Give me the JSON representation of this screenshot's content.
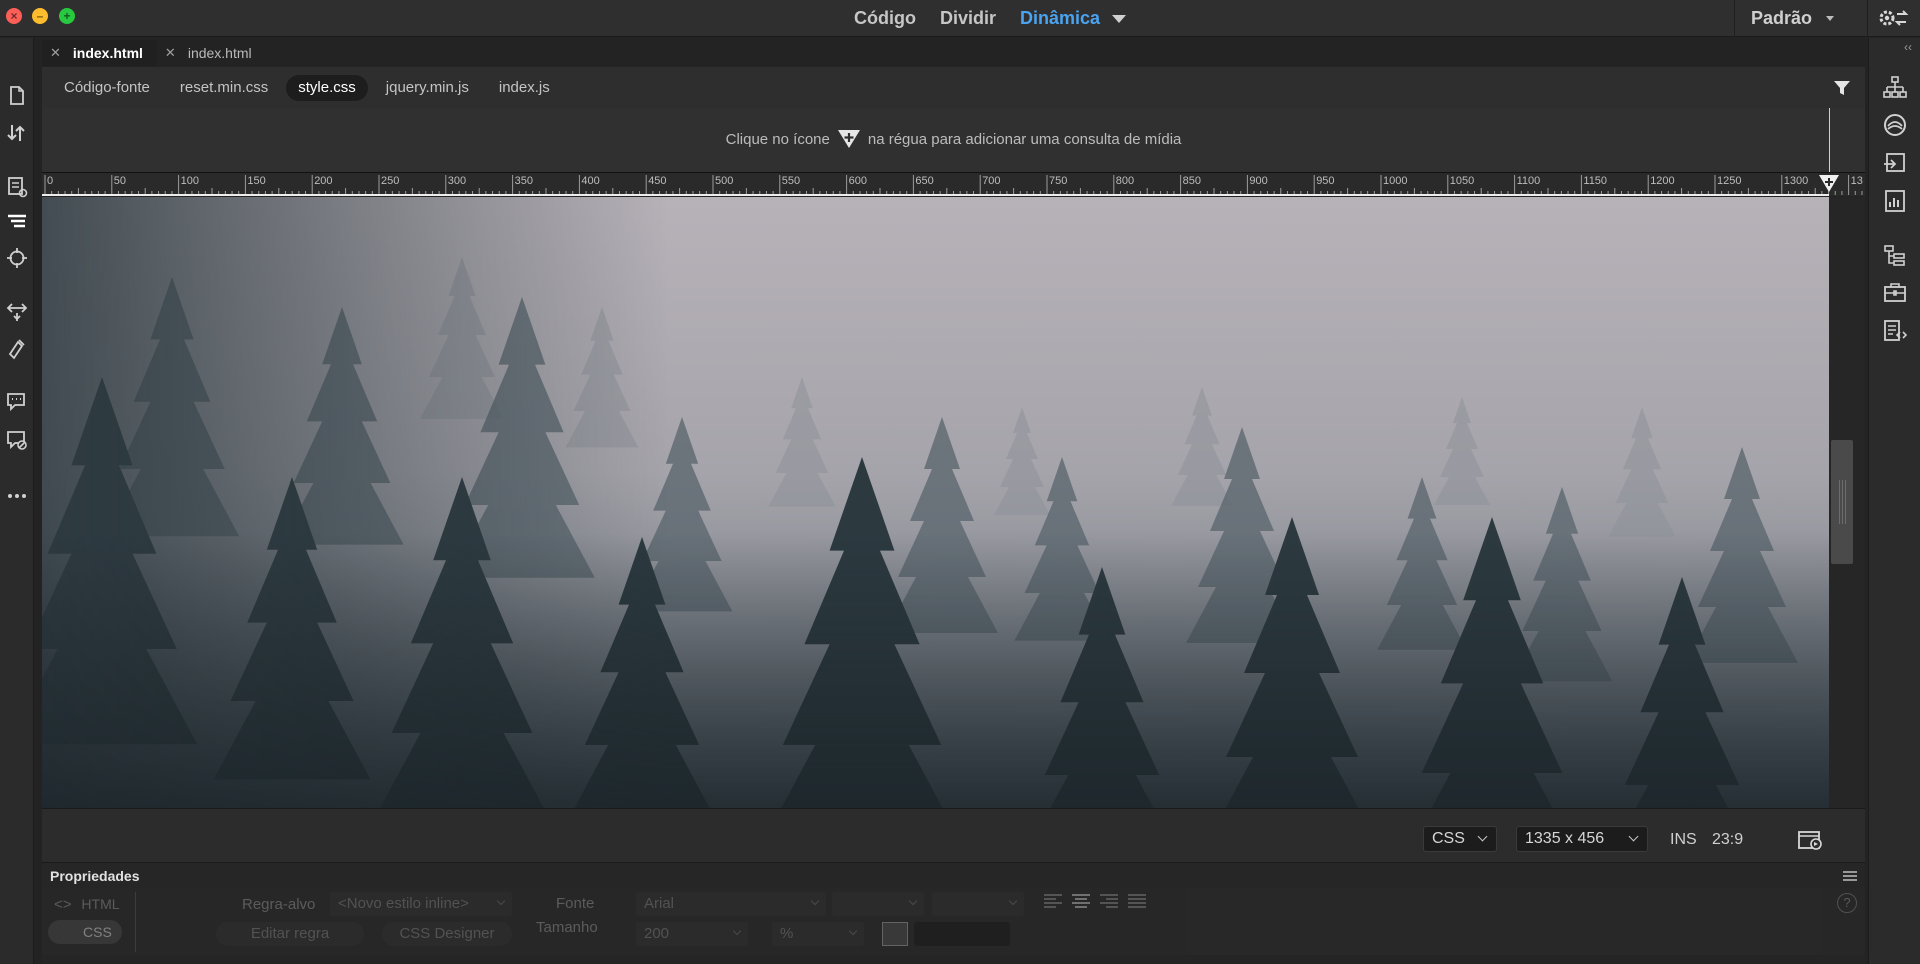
{
  "title_bar": {
    "view_modes": [
      "Código",
      "Dividir",
      "Dinâmica"
    ],
    "active_view": "Dinâmica",
    "workspace": "Padrão"
  },
  "doc_tabs": [
    {
      "label": "index.html",
      "active": true
    },
    {
      "label": "index.html",
      "active": false
    }
  ],
  "related_files": [
    "Código-fonte",
    "reset.min.css",
    "style.css",
    "jquery.min.js",
    "index.js"
  ],
  "related_active": "style.css",
  "media_query": {
    "hint_before": "Clique no ícone",
    "hint_after": "na régua para adicionar uma consulta de mídia"
  },
  "ruler": {
    "ticks": [
      "0",
      "50",
      "100",
      "150",
      "200",
      "250",
      "300",
      "350",
      "400",
      "450",
      "500",
      "550",
      "600",
      "650",
      "700",
      "750",
      "800",
      "850",
      "900",
      "950",
      "1000",
      "1050",
      "1100",
      "1150",
      "1200",
      "1250",
      "1300",
      "13"
    ]
  },
  "status_bar": {
    "language": "CSS",
    "window_size": "1335 x 456",
    "mode": "INS",
    "cursor_position": "23:9"
  },
  "properties": {
    "title": "Propriedades",
    "html_label": "HTML",
    "css_label": "CSS",
    "target_rule_label": "Regra-alvo",
    "target_rule_value": "<Novo estilo inline>",
    "edit_rule": "Editar regra",
    "css_designer": "CSS Designer",
    "font_label": "Fonte",
    "font_value": "Arial",
    "size_label": "Tamanho",
    "size_value": "200",
    "size_unit": "%",
    "help": "?"
  },
  "colors": {
    "accent": "#4ba3f0",
    "chrome": "#2f2f2f",
    "panel": "#2d2d2d"
  }
}
